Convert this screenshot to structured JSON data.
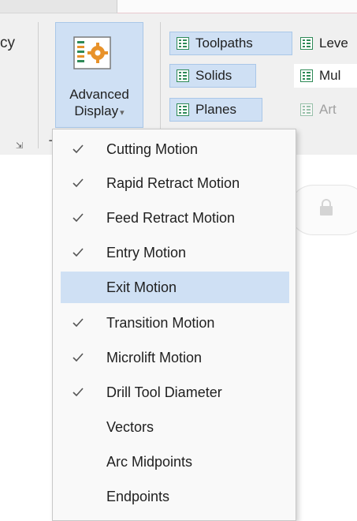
{
  "ribbon": {
    "left_group_fragment": "cy",
    "advanced_display": {
      "line1": "Advanced",
      "line2": "Display",
      "arrow": "▾",
      "icon": "advanced-display-icon"
    },
    "group_label_fragment": "T",
    "display_items": [
      {
        "label": "Toolpaths",
        "state": "selected"
      },
      {
        "label": "Leve",
        "state": "normal"
      },
      {
        "label": "Solids",
        "state": "selected"
      },
      {
        "label": "Mul",
        "state": "normal"
      },
      {
        "label": "Planes",
        "state": "selected"
      },
      {
        "label": "Art",
        "state": "disabled"
      }
    ]
  },
  "menu": {
    "items": [
      {
        "label": "Cutting Motion",
        "checked": true
      },
      {
        "label": "Rapid Retract Motion",
        "checked": true
      },
      {
        "label": "Feed Retract Motion",
        "checked": true
      },
      {
        "label": "Entry Motion",
        "checked": true
      },
      {
        "label": "Exit Motion",
        "checked": false,
        "highlighted": true
      },
      {
        "label": "Transition Motion",
        "checked": true
      },
      {
        "label": "Microlift Motion",
        "checked": true
      },
      {
        "label": "Drill Tool Diameter",
        "checked": true
      },
      {
        "label": "Vectors",
        "checked": false
      },
      {
        "label": "Arc Midpoints",
        "checked": false
      },
      {
        "label": "Endpoints",
        "checked": false
      }
    ]
  },
  "colors": {
    "accent_selected": "#cfe0f4",
    "accent_border": "#a9c7e8",
    "icon_orange": "#e8922a",
    "icon_green": "#2e8a57"
  }
}
